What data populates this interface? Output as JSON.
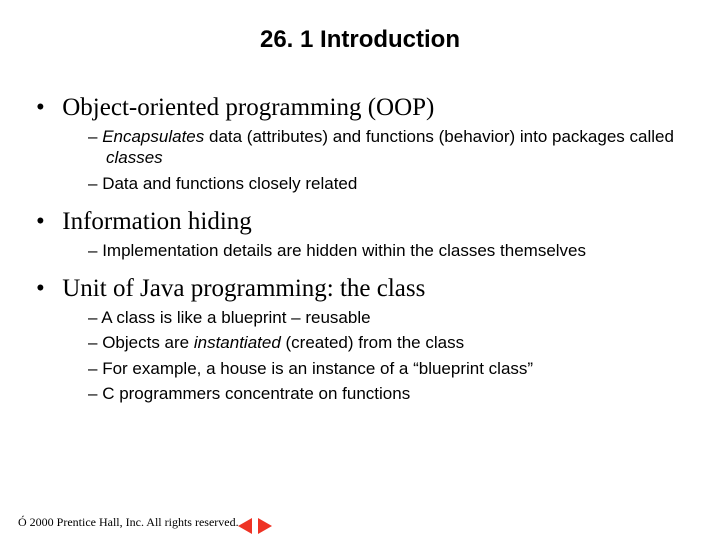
{
  "title": "26. 1  Introduction",
  "bullets": {
    "oop": {
      "text": "Object-oriented programming (OOP)",
      "sub1_pre": "Encapsulates",
      "sub1_mid": " data (attributes) and functions (behavior) into packages called ",
      "sub1_post": "classes",
      "sub2": "Data and functions closely related"
    },
    "info": {
      "text": "Information hiding",
      "sub1": "Implementation details are hidden within the classes themselves"
    },
    "unit": {
      "text": "Unit of Java programming: the class",
      "sub1": "A class is like a blueprint – reusable",
      "sub2_pre": "Objects are ",
      "sub2_ital": "instantiated",
      "sub2_post": " (created) from the class",
      "sub3": "For example, a house is an instance of a “blueprint class”",
      "sub4": "C programmers concentrate on functions"
    }
  },
  "footer": "Ó 2000 Prentice Hall, Inc.  All rights reserved."
}
